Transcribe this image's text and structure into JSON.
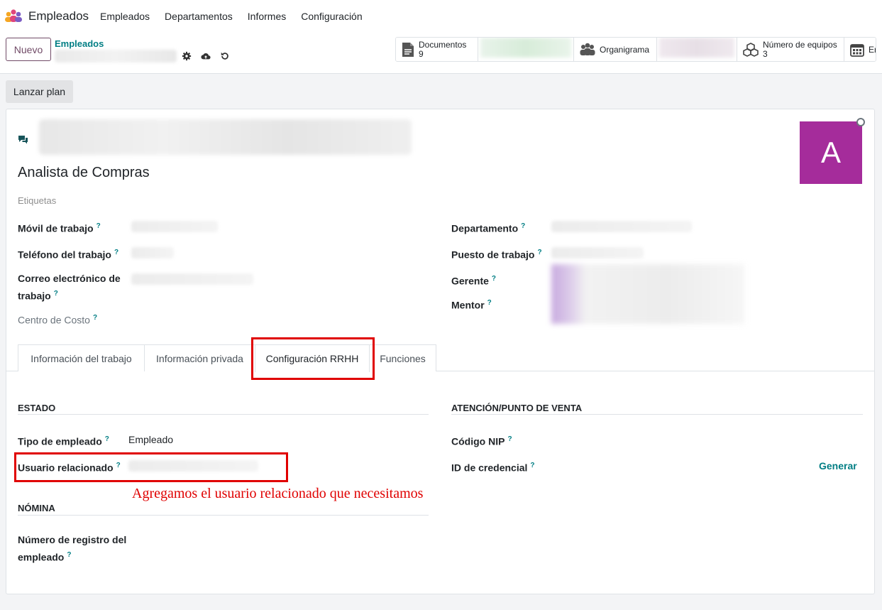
{
  "app": {
    "name": "Empleados"
  },
  "nav": [
    "Empleados",
    "Departamentos",
    "Informes",
    "Configuración"
  ],
  "control": {
    "new_label": "Nuevo",
    "breadcrumb": "Empleados",
    "launch_plan": "Lanzar plan"
  },
  "smart_buttons": [
    {
      "label": "Documentos",
      "count": "9",
      "icon": "document-icon"
    },
    {
      "label": "Organigrama",
      "icon": "people-icon"
    },
    {
      "label": "Número de equipos",
      "count": "3",
      "icon": "cubes-icon"
    },
    {
      "label": "Er",
      "icon": "calendar-icon"
    }
  ],
  "employee": {
    "job_title": "Analista de Compras",
    "avatar_letter": "A",
    "tags_placeholder": "Etiquetas",
    "avatar_color": "#a52c9b"
  },
  "fields_left": {
    "work_mobile": "Móvil de trabajo",
    "work_phone": "Teléfono del trabajo",
    "work_email_1": "Correo electrónico de",
    "work_email_2": "trabajo",
    "cost_center": "Centro de Costo"
  },
  "fields_right": {
    "department": "Departamento",
    "job_position": "Puesto de trabajo",
    "manager": "Gerente",
    "mentor": "Mentor"
  },
  "tabs": [
    "Información del trabajo",
    "Información privada",
    "Configuración RRHH",
    "Funciones"
  ],
  "hr": {
    "status_title": "ESTADO",
    "employee_type_label": "Tipo de empleado",
    "employee_type_value": "Empleado",
    "related_user_label": "Usuario relacionado",
    "payroll_title": "NÓMINA",
    "reg_number_1": "Número de registro del",
    "reg_number_2": "empleado",
    "attendance_title": "ATENCIÓN/PUNTO DE VENTA",
    "pin_label": "Código NIP",
    "badge_label": "ID de credencial",
    "generate": "Generar"
  },
  "annotation": "Agregamos el usuario relacionado que necesitamos",
  "help_mark": "?",
  "colors": {
    "primary": "#714b67",
    "link": "#017e84",
    "annotation": "#e00000"
  }
}
